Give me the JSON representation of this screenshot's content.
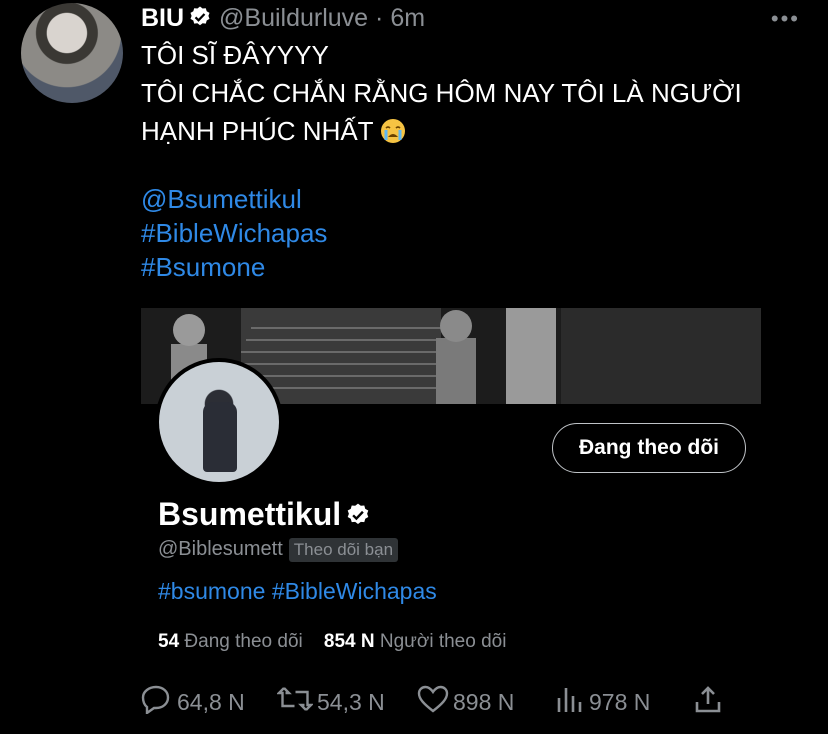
{
  "tweet": {
    "author_name": "BIU",
    "handle": "@Buildurluve",
    "separator": "·",
    "time": "6m",
    "more_label": "•••",
    "lines": [
      "TÔI SĨ ĐÂYYYY",
      "TÔI CHẮC CHẮN RẰNG HÔM NAY TÔI LÀ NGƯỜI",
      "HẠNH PHÚC NHẤT"
    ],
    "emoji": "loudly-crying-face",
    "mention": "@Bsumettikul",
    "hashtag1": "#BibleWichapas",
    "hashtag2": "#Bsumone"
  },
  "card": {
    "follow_button": "Đang theo dõi",
    "name": "Bsumettikul",
    "handle": "@Biblesumett",
    "follows_you": "Theo dõi bạn",
    "bio_tag1": "#bsumone",
    "bio_tag2": "#BibleWichapas",
    "following_count": "54",
    "following_label": "Đang theo dõi",
    "followers_count": "854 N",
    "followers_label": "Người theo dõi"
  },
  "actions": {
    "replies": "64,8 N",
    "retweets": "54,3 N",
    "likes": "898 N",
    "views": "978 N"
  },
  "colors": {
    "background": "#000000",
    "link": "#2f89e6",
    "muted": "#8b8f94",
    "verified": "#ffffff"
  }
}
